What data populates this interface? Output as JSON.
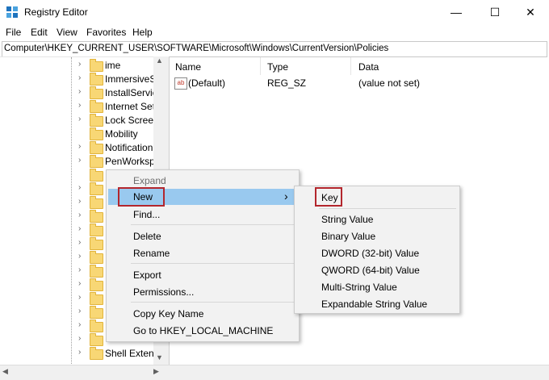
{
  "window": {
    "title": "Registry Editor",
    "minimize": "—",
    "maximize": "☐",
    "close": "✕"
  },
  "menu": [
    "File",
    "Edit",
    "View",
    "Favorites",
    "Help"
  ],
  "address": "Computer\\HKEY_CURRENT_USER\\SOFTWARE\\Microsoft\\Windows\\CurrentVersion\\Policies",
  "tree": {
    "items": [
      {
        "label": "ime"
      },
      {
        "label": "ImmersiveS"
      },
      {
        "label": "InstallServic"
      },
      {
        "label": "Internet Set"
      },
      {
        "label": "Lock Screen"
      },
      {
        "label": "Mobility"
      },
      {
        "label": "Notification"
      },
      {
        "label": "PenWorksp"
      }
    ],
    "bottom_items": [
      {
        "label": "Shell Extens"
      }
    ]
  },
  "list": {
    "columns": [
      "Name",
      "Type",
      "Data"
    ],
    "rows": [
      {
        "name": "(Default)",
        "type": "REG_SZ",
        "data": "(value not set)"
      }
    ]
  },
  "context_menu": {
    "items": [
      "Expand",
      "New",
      "Find...",
      "Delete",
      "Rename",
      "Export",
      "Permissions...",
      "Copy Key Name",
      "Go to HKEY_LOCAL_MACHINE"
    ],
    "submenu_arrow": "›"
  },
  "submenu": {
    "items": [
      "Key",
      "String Value",
      "Binary Value",
      "DWORD (32-bit) Value",
      "QWORD (64-bit) Value",
      "Multi-String Value",
      "Expandable String Value"
    ]
  },
  "colors": {
    "highlight": "#99c9ef",
    "annotation": "#b3262d",
    "folder": "#f8d775"
  }
}
